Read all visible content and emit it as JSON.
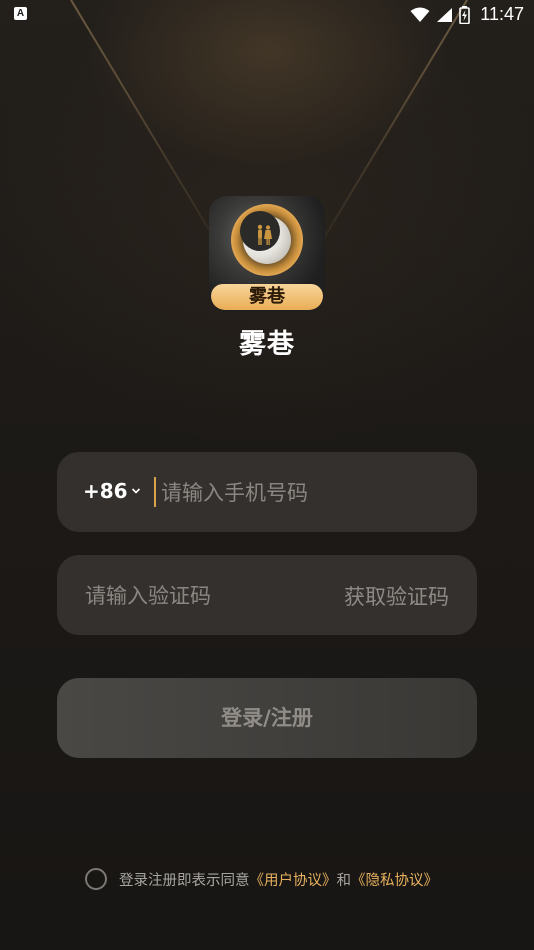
{
  "status_bar": {
    "notification_icon_letter": "A",
    "icons": [
      "wifi-icon",
      "signal-icon",
      "battery-charging-icon"
    ],
    "time": "11:47"
  },
  "app": {
    "logo_banner_text": "雾巷",
    "name": "雾巷"
  },
  "phone_field": {
    "country_code": "+86",
    "placeholder": "请输入手机号码",
    "value": ""
  },
  "code_field": {
    "placeholder": "请输入验证码",
    "value": "",
    "get_code_label": "获取验证码"
  },
  "login_button": {
    "label": "登录/注册"
  },
  "agreement": {
    "checked": false,
    "prefix": "登录注册即表示同意",
    "user_agreement": "《用户协议》",
    "conjunction": "和",
    "privacy_agreement": "《隐私协议》"
  },
  "colors": {
    "accent": "#e7b15d",
    "field_bg": "#33302d",
    "background": "#1b1816"
  }
}
